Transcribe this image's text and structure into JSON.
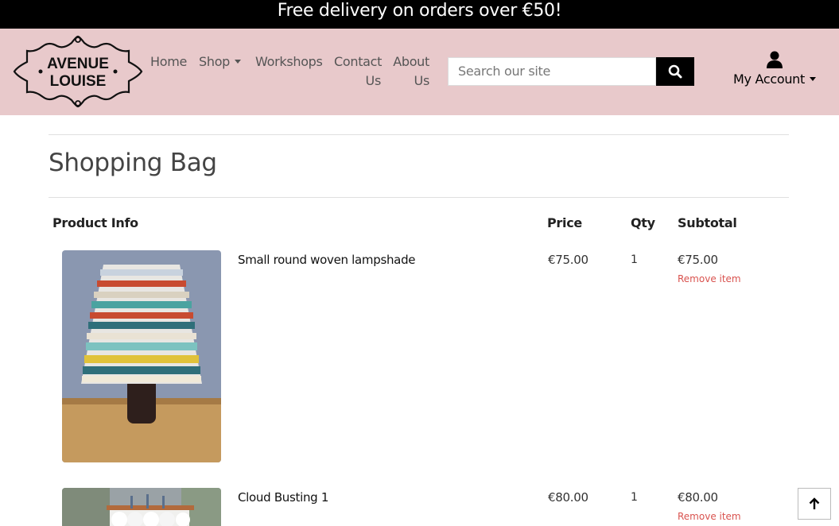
{
  "promo": {
    "text": "Free delivery on orders over €50!"
  },
  "brand": {
    "line1": "AVENUE",
    "line2": "LOUISE"
  },
  "nav": {
    "home": "Home",
    "shop": "Shop",
    "workshops": "Workshops",
    "contact_1": "Contact",
    "contact_2": "Us",
    "about_1": "About",
    "about_2": "Us"
  },
  "search": {
    "placeholder": "Search our site",
    "icon": "search-icon"
  },
  "account": {
    "label": "My Account",
    "icon": "user-icon"
  },
  "page": {
    "title": "Shopping Bag"
  },
  "table": {
    "headers": {
      "product": "Product Info",
      "price": "Price",
      "qty": "Qty",
      "subtotal": "Subtotal"
    },
    "rows": [
      {
        "name": "Small round woven lampshade",
        "price": "€75.00",
        "qty": "1",
        "subtotal": "€75.00",
        "remove": "Remove item"
      },
      {
        "name": "Cloud Busting 1",
        "price": "€80.00",
        "qty": "1",
        "subtotal": "€80.00",
        "remove": "Remove item"
      }
    ]
  },
  "colors": {
    "header_bg": "#e8c9cb",
    "promo_bg": "#000000",
    "remove": "#d9534f"
  }
}
